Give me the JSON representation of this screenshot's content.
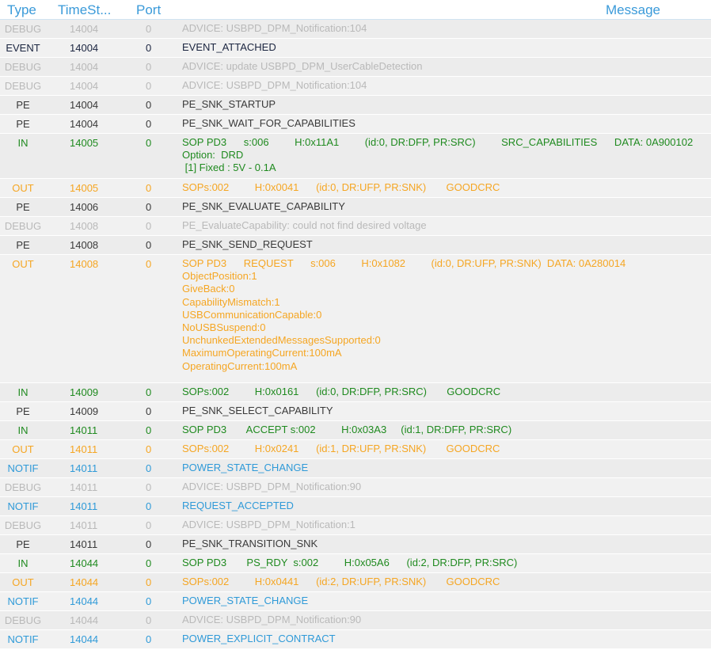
{
  "columns": {
    "type": "Type",
    "timestamp": "TimeSt...",
    "port": "Port",
    "message": "Message"
  },
  "rows": [
    {
      "type": "DEBUG",
      "time": "14004",
      "port": "0",
      "message": "ADVICE: USBPD_DPM_Notification:104"
    },
    {
      "type": "EVENT",
      "time": "14004",
      "port": "0",
      "message": "EVENT_ATTACHED"
    },
    {
      "type": "DEBUG",
      "time": "14004",
      "port": "0",
      "message": "ADVICE: update USBPD_DPM_UserCableDetection"
    },
    {
      "type": "DEBUG",
      "time": "14004",
      "port": "0",
      "message": "ADVICE: USBPD_DPM_Notification:104"
    },
    {
      "type": "PE",
      "time": "14004",
      "port": "0",
      "message": "PE_SNK_STARTUP"
    },
    {
      "type": "PE",
      "time": "14004",
      "port": "0",
      "message": "PE_SNK_WAIT_FOR_CAPABILITIES"
    },
    {
      "type": "IN",
      "time": "14005",
      "port": "0",
      "message": "SOP PD3      s:006         H:0x11A1         (id:0, DR:DFP, PR:SRC)         SRC_CAPABILITIES      DATA: 0A900102\nOption:  DRD\n [1] Fixed : 5V - 0.1A"
    },
    {
      "type": "OUT",
      "time": "14005",
      "port": "0",
      "message": "SOPs:002         H:0x0041      (id:0, DR:UFP, PR:SNK)       GOODCRC"
    },
    {
      "type": "PE",
      "time": "14006",
      "port": "0",
      "message": "PE_SNK_EVALUATE_CAPABILITY"
    },
    {
      "type": "DEBUG",
      "time": "14008",
      "port": "0",
      "message": "PE_EvaluateCapability: could not find desired voltage"
    },
    {
      "type": "PE",
      "time": "14008",
      "port": "0",
      "message": "PE_SNK_SEND_REQUEST"
    },
    {
      "type": "OUT",
      "time": "14008",
      "port": "0",
      "message": "SOP PD3      REQUEST      s:006         H:0x1082         (id:0, DR:UFP, PR:SNK)  DATA: 0A280014\nObjectPosition:1\nGiveBack:0\nCapabilityMismatch:1\nUSBCommunicationCapable:0\nNoUSBSuspend:0\nUnchunkedExtendedMessagesSupported:0\nMaximumOperatingCurrent:100mA\nOperatingCurrent:100mA"
    },
    {
      "type": "IN",
      "time": "14009",
      "port": "0",
      "message": "SOPs:002         H:0x0161      (id:0, DR:DFP, PR:SRC)       GOODCRC"
    },
    {
      "type": "PE",
      "time": "14009",
      "port": "0",
      "message": "PE_SNK_SELECT_CAPABILITY"
    },
    {
      "type": "IN",
      "time": "14011",
      "port": "0",
      "message": "SOP PD3       ACCEPT s:002         H:0x03A3     (id:1, DR:DFP, PR:SRC)"
    },
    {
      "type": "OUT",
      "time": "14011",
      "port": "0",
      "message": "SOPs:002         H:0x0241      (id:1, DR:UFP, PR:SNK)       GOODCRC"
    },
    {
      "type": "NOTIF",
      "time": "14011",
      "port": "0",
      "message": "POWER_STATE_CHANGE"
    },
    {
      "type": "DEBUG",
      "time": "14011",
      "port": "0",
      "message": "ADVICE: USBPD_DPM_Notification:90"
    },
    {
      "type": "NOTIF",
      "time": "14011",
      "port": "0",
      "message": "REQUEST_ACCEPTED"
    },
    {
      "type": "DEBUG",
      "time": "14011",
      "port": "0",
      "message": "ADVICE: USBPD_DPM_Notification:1"
    },
    {
      "type": "PE",
      "time": "14011",
      "port": "0",
      "message": "PE_SNK_TRANSITION_SNK"
    },
    {
      "type": "IN",
      "time": "14044",
      "port": "0",
      "message": "SOP PD3       PS_RDY  s:002         H:0x05A6      (id:2, DR:DFP, PR:SRC)"
    },
    {
      "type": "OUT",
      "time": "14044",
      "port": "0",
      "message": "SOPs:002         H:0x0441      (id:2, DR:UFP, PR:SNK)       GOODCRC"
    },
    {
      "type": "NOTIF",
      "time": "14044",
      "port": "0",
      "message": "POWER_STATE_CHANGE"
    },
    {
      "type": "DEBUG",
      "time": "14044",
      "port": "0",
      "message": "ADVICE: USBPD_DPM_Notification:90"
    },
    {
      "type": "NOTIF",
      "time": "14044",
      "port": "0",
      "message": "POWER_EXPLICIT_CONTRACT"
    }
  ],
  "type_colors": {
    "DEBUG": "#b9b9b9",
    "EVENT": "#1b2540",
    "PE": "#3a3a3a",
    "IN": "#1f8a1f",
    "OUT": "#f5a623",
    "NOTIF": "#2f9ad8"
  }
}
